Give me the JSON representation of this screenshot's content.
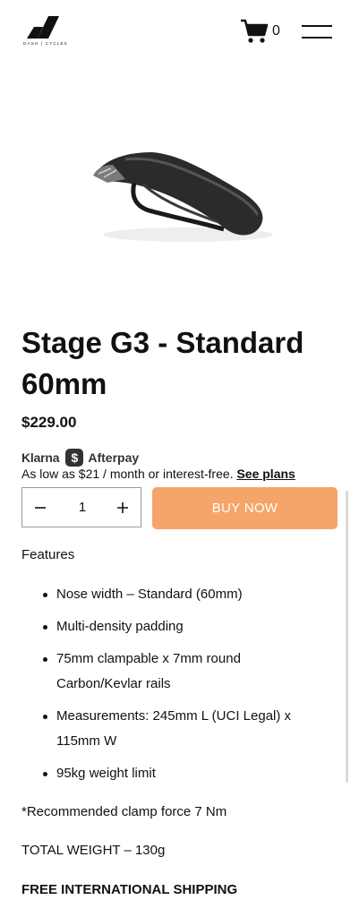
{
  "header": {
    "logo_text": "DASH | CYCLES",
    "cart_count": "0"
  },
  "product": {
    "title": "Stage G3 - Standard 60mm",
    "price": "$229.00",
    "payment": {
      "klarna": "Klarna",
      "afterpay_badge": "$",
      "afterpay": "Afterpay",
      "installment_text": "As low as $21 / month or interest-free.",
      "see_plans": "See plans"
    },
    "quantity": "1",
    "buy_label": "BUY NOW",
    "features_heading": "Features",
    "features": [
      "Nose width – Standard (60mm)",
      "Multi-density padding",
      "75mm clampable x 7mm round Carbon/Kevlar rails",
      "Measurements: 245mm L (UCI Legal) x 115mm W",
      "95kg weight limit"
    ],
    "clamp_note": "*Recommended clamp force 7 Nm",
    "total_weight": "TOTAL WEIGHT – 130g",
    "shipping": "FREE INTERNATIONAL SHIPPING"
  },
  "colors": {
    "buy_button": "#f6a56a",
    "text": "#111111",
    "background": "#ffffff"
  },
  "icons": {
    "cart": "cart-icon",
    "menu": "hamburger-menu-icon",
    "minus": "minus-icon",
    "plus": "plus-icon"
  }
}
